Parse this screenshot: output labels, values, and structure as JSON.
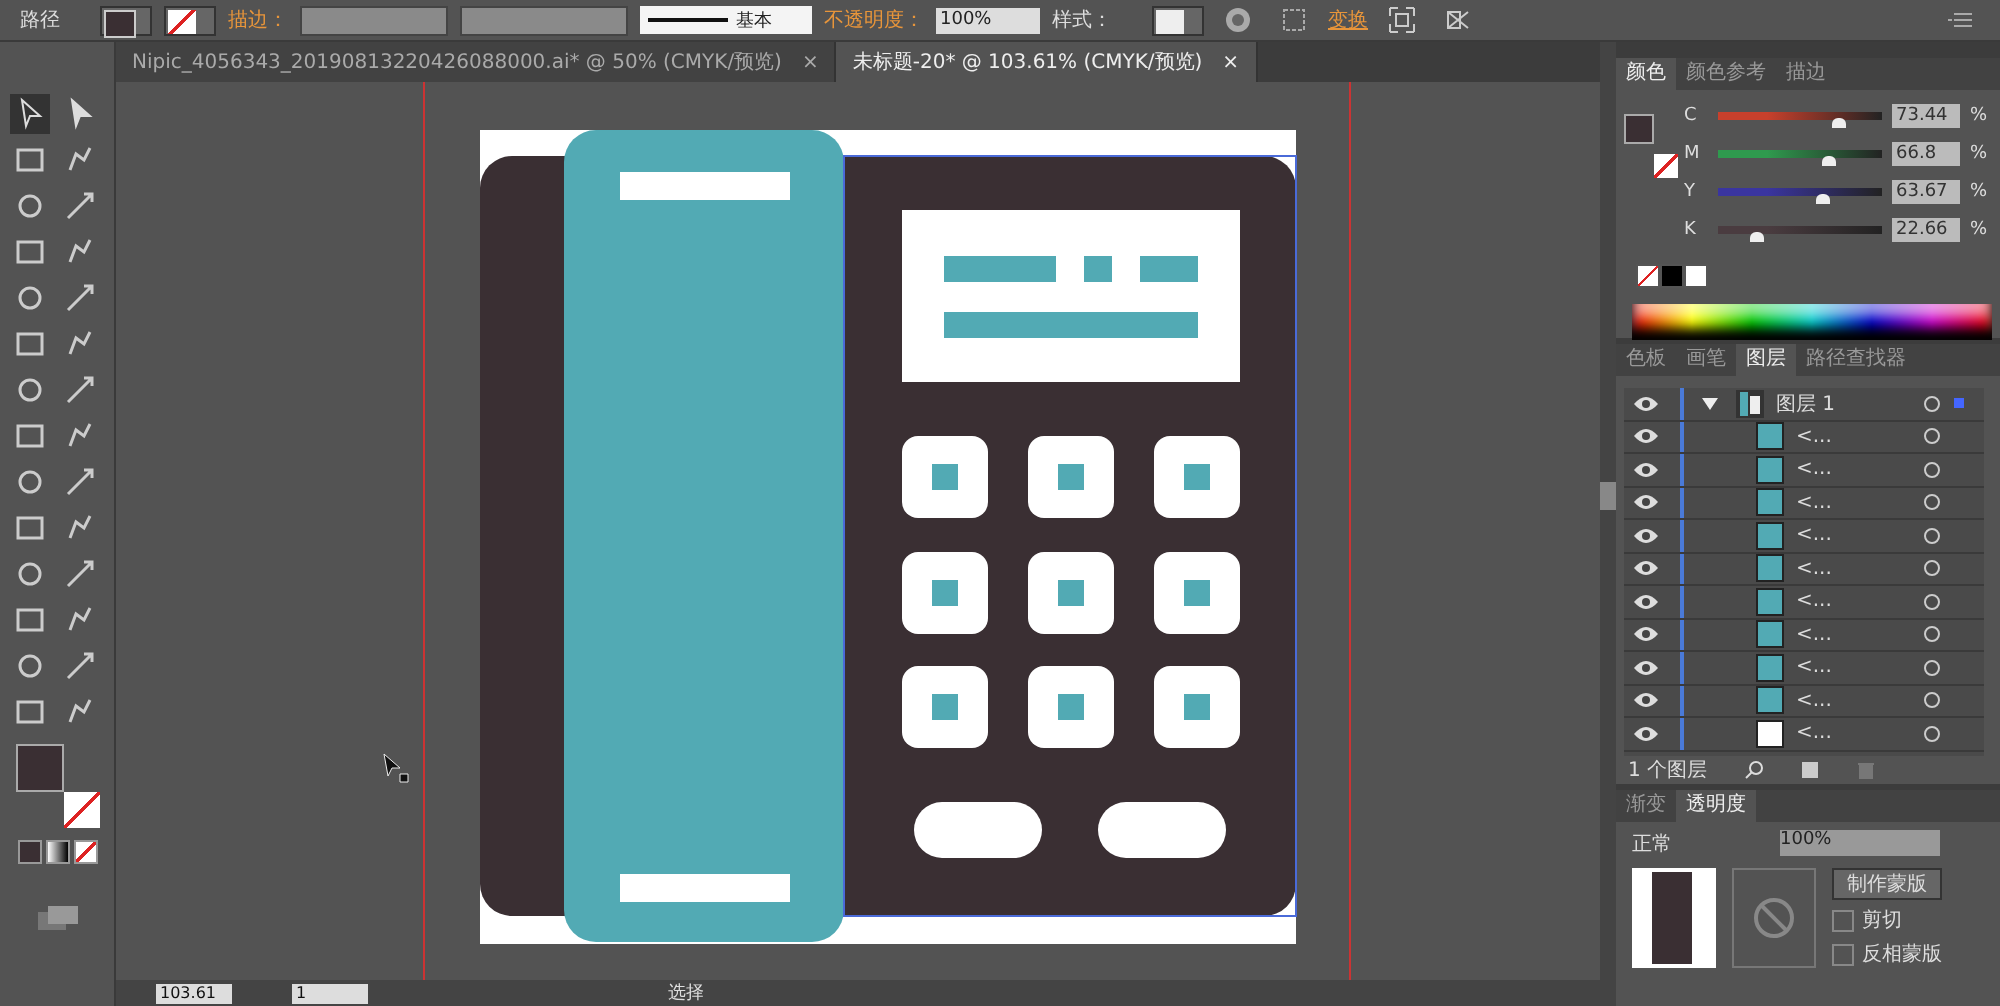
{
  "control_bar": {
    "object_type": "路径",
    "stroke_label": "描边：",
    "stroke_profile": "基本",
    "opacity_label": "不透明度：",
    "opacity": "100%",
    "style_label": "样式：",
    "transform_link": "变换"
  },
  "tabs": [
    {
      "label": "Nipic_4056343_20190813220426088000.ai* @ 50% (CMYK/预览)",
      "close": "×",
      "selected": false
    },
    {
      "label": "未标题-20* @ 103.61% (CMYK/预览)",
      "close": "×",
      "selected": true
    }
  ],
  "color_panel": {
    "tabs": [
      {
        "label": "颜色",
        "selected": true
      },
      {
        "label": "颜色参考",
        "selected": false
      },
      {
        "label": "描边",
        "selected": false
      }
    ],
    "channels": [
      {
        "name": "C",
        "level": 0.734,
        "reading": "73.44",
        "color": "#c8402c"
      },
      {
        "name": "M",
        "level": 0.668,
        "reading": "66.8",
        "color": "#2f9a4e"
      },
      {
        "name": "Y",
        "level": 0.637,
        "reading": "63.67",
        "color": "#3a35a0"
      },
      {
        "name": "K",
        "level": 0.227,
        "reading": "22.66",
        "color": "#4a3c40"
      }
    ],
    "unit": "%"
  },
  "layers_panel": {
    "tabs": [
      {
        "label": "色板",
        "selected": false
      },
      {
        "label": "画笔",
        "selected": false
      },
      {
        "label": "图层",
        "selected": true
      },
      {
        "label": "路径查找器",
        "selected": false
      }
    ],
    "layers": [
      {
        "name": "图层 1",
        "expanded": true,
        "children": [
          {
            "name": "<...",
            "color": "#52aab4"
          },
          {
            "name": "<...",
            "color": "#52aab4"
          },
          {
            "name": "<...",
            "color": "#52aab4"
          },
          {
            "name": "<...",
            "color": "#52aab4"
          },
          {
            "name": "<...",
            "color": "#52aab4"
          },
          {
            "name": "<...",
            "color": "#52aab4"
          },
          {
            "name": "<...",
            "color": "#52aab4"
          },
          {
            "name": "<...",
            "color": "#52aab4"
          },
          {
            "name": "<...",
            "color": "#52aab4"
          },
          {
            "name": "<...",
            "color": "#ffffff"
          }
        ]
      }
    ],
    "footer": "1 个图层"
  },
  "transparency_panel": {
    "tabs": [
      {
        "label": "渐变",
        "selected": false
      },
      {
        "label": "透明度",
        "selected": true
      }
    ],
    "blend_mode": "正常",
    "opacity": "100%",
    "make_mask": "制作蒙版",
    "options": [
      {
        "label": "剪切",
        "checked": false
      },
      {
        "label": "反相蒙版",
        "checked": false
      }
    ]
  },
  "status_bar": {
    "zoom": "103.61",
    "artboard": "1",
    "tool": "选择"
  }
}
